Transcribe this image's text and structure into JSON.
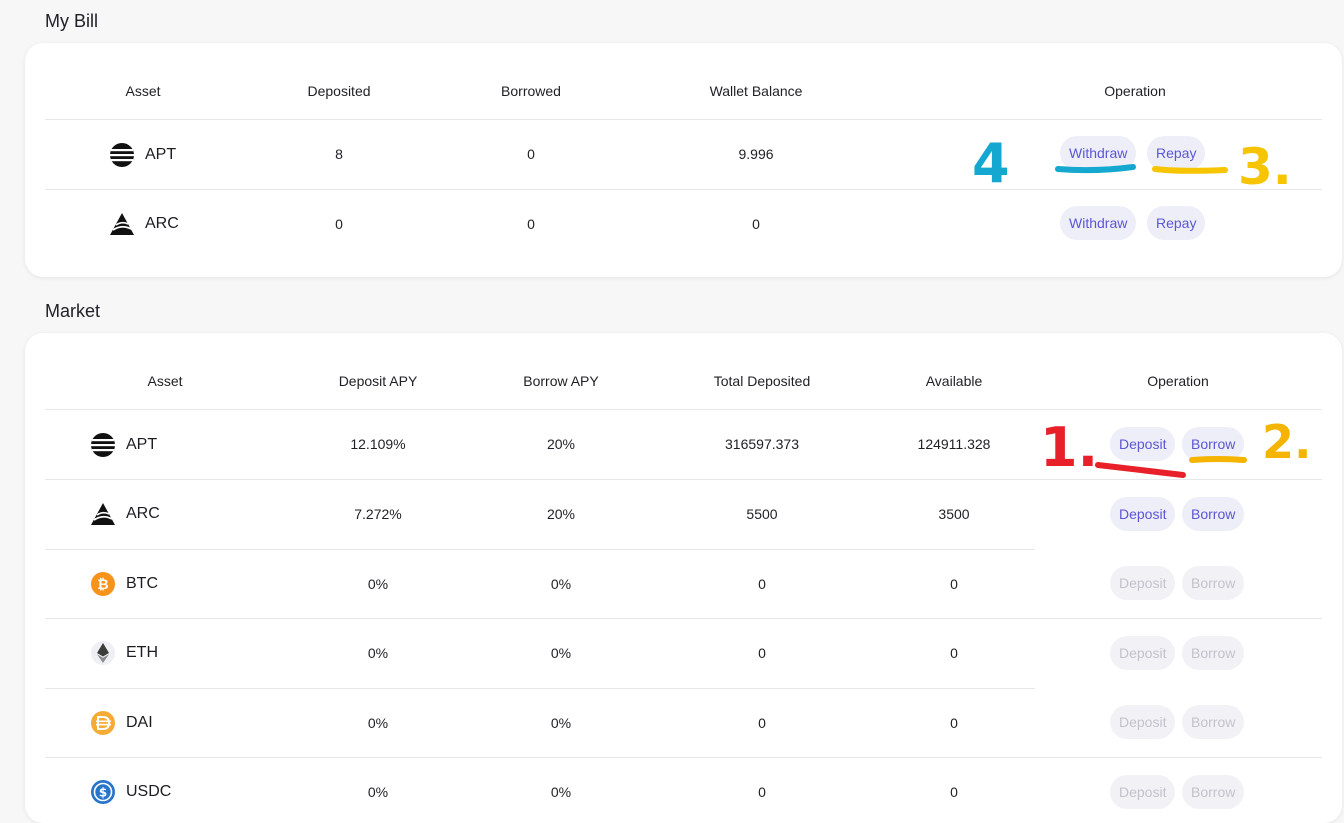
{
  "my_bill": {
    "title": "My Bill",
    "headers": [
      "Asset",
      "Deposited",
      "Borrowed",
      "Wallet Balance",
      "Operation"
    ],
    "rows": [
      {
        "asset": "APT",
        "deposited": "8",
        "borrowed": "0",
        "wallet_balance": "9.996",
        "withdraw": "Withdraw",
        "repay": "Repay"
      },
      {
        "asset": "ARC",
        "deposited": "0",
        "borrowed": "0",
        "wallet_balance": "0",
        "withdraw": "Withdraw",
        "repay": "Repay"
      }
    ]
  },
  "market": {
    "title": "Market",
    "headers": [
      "Asset",
      "Deposit APY",
      "Borrow APY",
      "Total Deposited",
      "Available",
      "Operation"
    ],
    "rows": [
      {
        "asset": "APT",
        "deposit_apy": "12.109%",
        "borrow_apy": "20%",
        "total_deposited": "316597.373",
        "available": "124911.328",
        "deposit": "Deposit",
        "borrow": "Borrow",
        "enabled": true
      },
      {
        "asset": "ARC",
        "deposit_apy": "7.272%",
        "borrow_apy": "20%",
        "total_deposited": "5500",
        "available": "3500",
        "deposit": "Deposit",
        "borrow": "Borrow",
        "enabled": true
      },
      {
        "asset": "BTC",
        "deposit_apy": "0%",
        "borrow_apy": "0%",
        "total_deposited": "0",
        "available": "0",
        "deposit": "Deposit",
        "borrow": "Borrow",
        "enabled": false
      },
      {
        "asset": "ETH",
        "deposit_apy": "0%",
        "borrow_apy": "0%",
        "total_deposited": "0",
        "available": "0",
        "deposit": "Deposit",
        "borrow": "Borrow",
        "enabled": false
      },
      {
        "asset": "DAI",
        "deposit_apy": "0%",
        "borrow_apy": "0%",
        "total_deposited": "0",
        "available": "0",
        "deposit": "Deposit",
        "borrow": "Borrow",
        "enabled": false
      },
      {
        "asset": "USDC",
        "deposit_apy": "0%",
        "borrow_apy": "0%",
        "total_deposited": "0",
        "available": "0",
        "deposit": "Deposit",
        "borrow": "Borrow",
        "enabled": false
      }
    ]
  },
  "annotations": {
    "step_1": "1.",
    "step_2": "2.",
    "step_3": "3.",
    "step_4": "4",
    "colors": {
      "red": "#e8202a",
      "orange": "#f4b400",
      "yellow": "#f6c400",
      "blue": "#14a7d0"
    }
  },
  "colors": {
    "accent": "#5b56d4",
    "button_bg": "#eeeef8",
    "disabled_text": "#c2c2cc"
  }
}
